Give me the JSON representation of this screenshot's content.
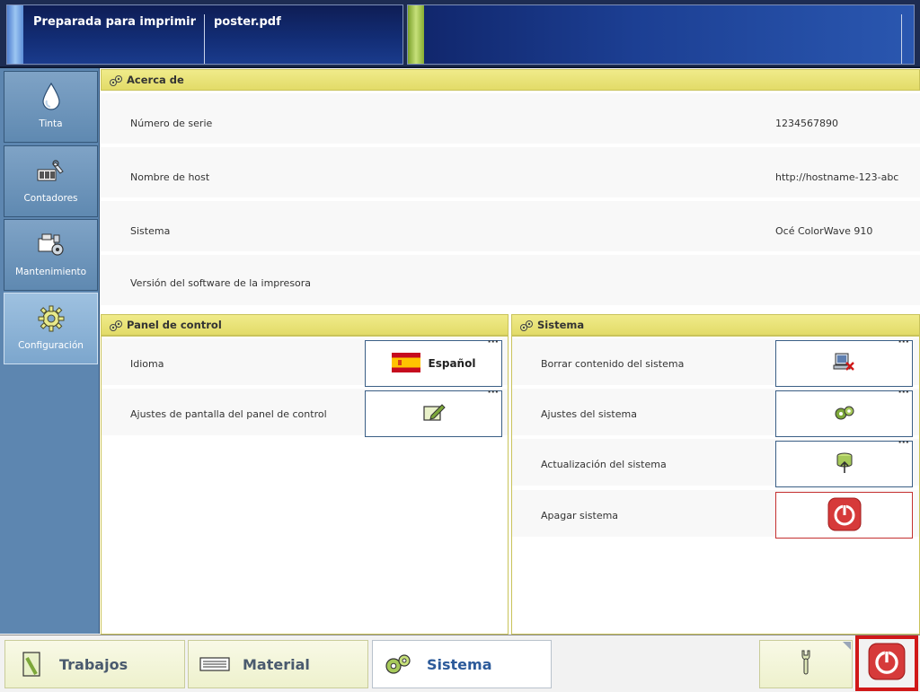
{
  "status_bar": {
    "job_state": "Preparada para imprimir",
    "file_name": "poster.pdf"
  },
  "sidebar": {
    "items": [
      {
        "label": "Tinta",
        "icon": "ink-drop-icon"
      },
      {
        "label": "Contadores",
        "icon": "counters-icon"
      },
      {
        "label": "Mantenimiento",
        "icon": "maintenance-icon"
      },
      {
        "label": "Configuración",
        "icon": "gear-icon"
      }
    ]
  },
  "about": {
    "title": "Acerca de",
    "rows": [
      {
        "label": "Número de serie",
        "value": "1234567890"
      },
      {
        "label": "Nombre de host",
        "value": "http://hostname-123-abc"
      },
      {
        "label": "Sistema",
        "value": "Océ ColorWave 910"
      },
      {
        "label": "Versión del software de la impresora",
        "value": ""
      }
    ]
  },
  "control_panel": {
    "title": "Panel de control",
    "rows": [
      {
        "label": "Idioma",
        "button": "Español",
        "icon": "spain-flag-icon"
      },
      {
        "label": "Ajustes de pantalla del panel de control",
        "button": "",
        "icon": "edit-screen-icon"
      }
    ]
  },
  "system": {
    "title": "Sistema",
    "rows": [
      {
        "label": "Borrar contenido del sistema",
        "icon": "erase-system-icon"
      },
      {
        "label": "Ajustes del sistema",
        "icon": "system-settings-icon"
      },
      {
        "label": "Actualización del sistema",
        "icon": "system-update-icon"
      },
      {
        "label": "Apagar sistema",
        "icon": "power-icon"
      }
    ]
  },
  "bottom_tabs": [
    {
      "label": "Trabajos",
      "icon": "jobs-icon"
    },
    {
      "label": "Material",
      "icon": "media-icon"
    },
    {
      "label": "Sistema",
      "icon": "system-gears-icon",
      "active": true
    }
  ],
  "more_indicator": "···",
  "colors": {
    "section_header": "#e2db68",
    "sidebar": "#5d86b0",
    "power_red": "#d01818"
  }
}
